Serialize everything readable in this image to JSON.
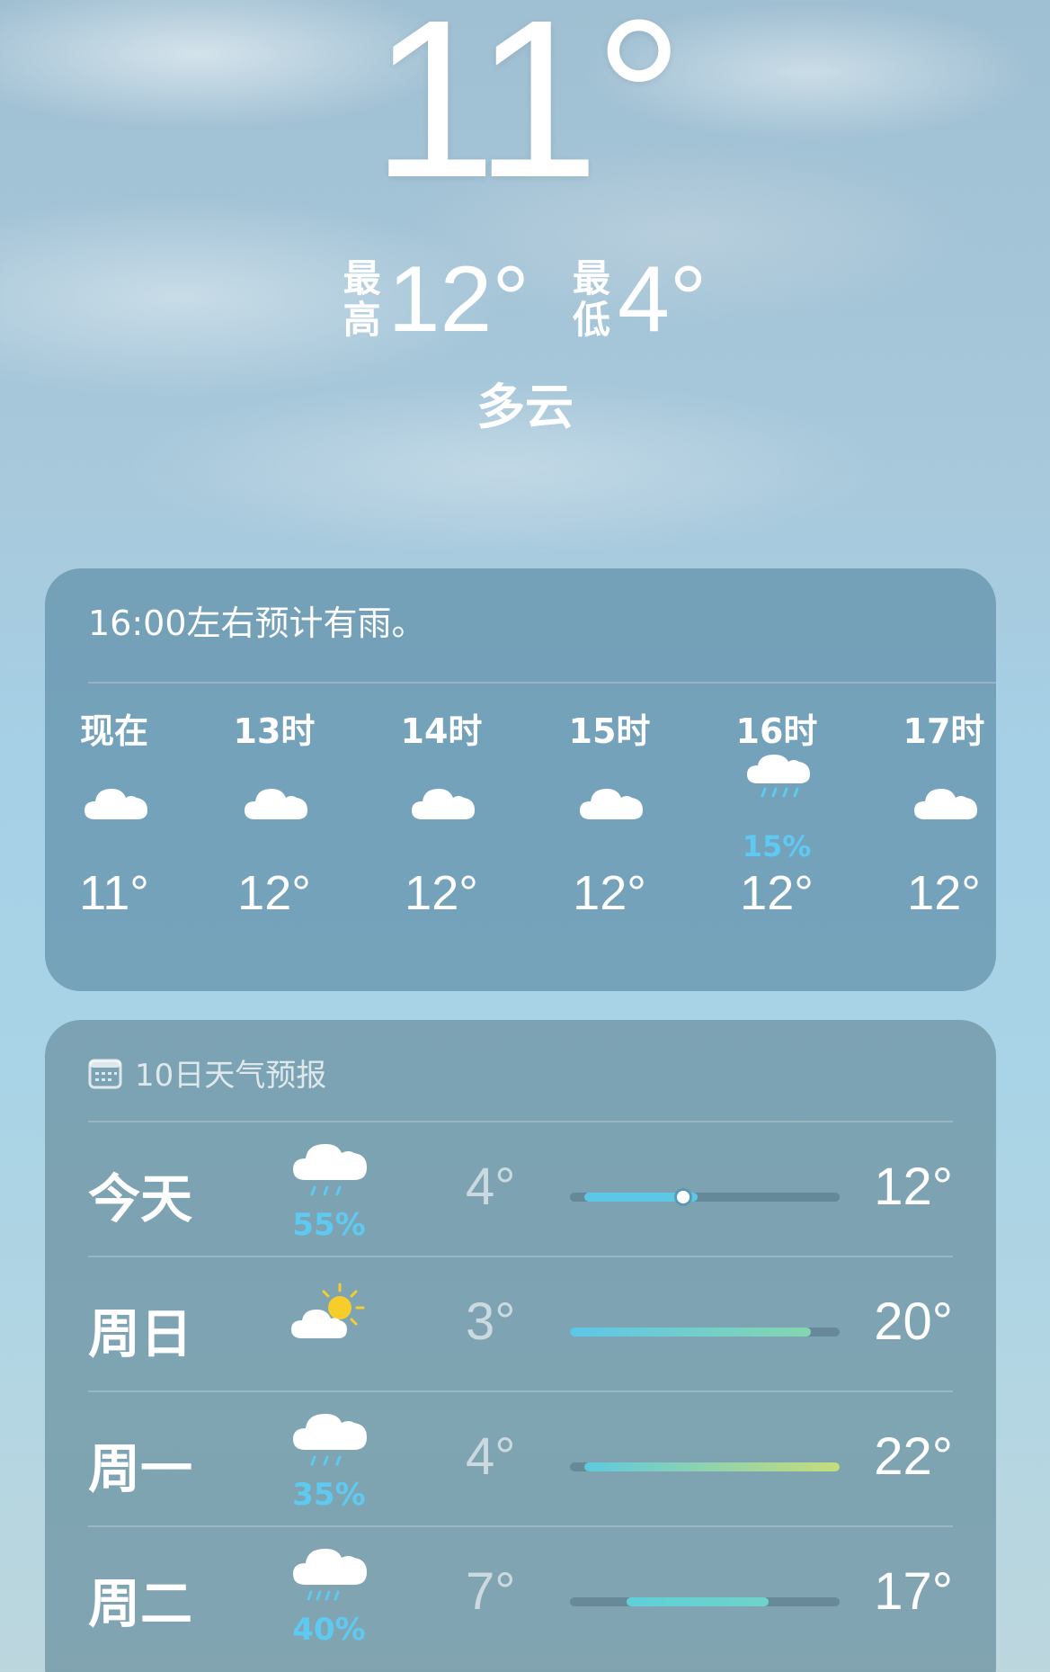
{
  "current": {
    "temp": "11°",
    "high_label_1": "最",
    "high_label_2": "高",
    "high": "12°",
    "low_label_1": "最",
    "low_label_2": "低",
    "low": "4°",
    "condition": "多云"
  },
  "hourly": {
    "summary": "16:00左右预计有雨。",
    "items": [
      {
        "label": "现在",
        "icon": "cloud-icon",
        "pop": "",
        "temp": "11°"
      },
      {
        "label": "13时",
        "icon": "cloud-icon",
        "pop": "",
        "temp": "12°"
      },
      {
        "label": "14时",
        "icon": "cloud-icon",
        "pop": "",
        "temp": "12°"
      },
      {
        "label": "15时",
        "icon": "cloud-icon",
        "pop": "",
        "temp": "12°"
      },
      {
        "label": "16时",
        "icon": "cloud-rain-icon",
        "pop": "15%",
        "temp": "12°"
      },
      {
        "label": "17时",
        "icon": "cloud-icon",
        "pop": "",
        "temp": "12°"
      }
    ]
  },
  "daily": {
    "header": "10日天气预报",
    "header_icon": "calendar-icon",
    "range_min": 3,
    "range_max": 22,
    "rows": [
      {
        "day": "今天",
        "icon": "cloud-rain-icon",
        "pop": "55%",
        "low": "4°",
        "high": "12°",
        "low_value": 4,
        "high_value": 12,
        "current_value": 11,
        "colors": [
          "#5cc8e6",
          "#5cc8e6"
        ]
      },
      {
        "day": "周日",
        "icon": "partly-sunny-icon",
        "pop": "",
        "low": "3°",
        "high": "20°",
        "low_value": 3,
        "high_value": 20,
        "colors": [
          "#5ec6e8",
          "#84d6b0"
        ]
      },
      {
        "day": "周一",
        "icon": "cloud-rain-icon",
        "pop": "35%",
        "low": "4°",
        "high": "22°",
        "low_value": 4,
        "high_value": 22,
        "colors": [
          "#5ec9df",
          "#c5dd7a"
        ]
      },
      {
        "day": "周二",
        "icon": "cloud-rain-icon",
        "pop": "40%",
        "low": "7°",
        "high": "17°",
        "low_value": 7,
        "high_value": 17,
        "colors": [
          "#5fd0d8",
          "#6fd3c9"
        ]
      }
    ]
  }
}
